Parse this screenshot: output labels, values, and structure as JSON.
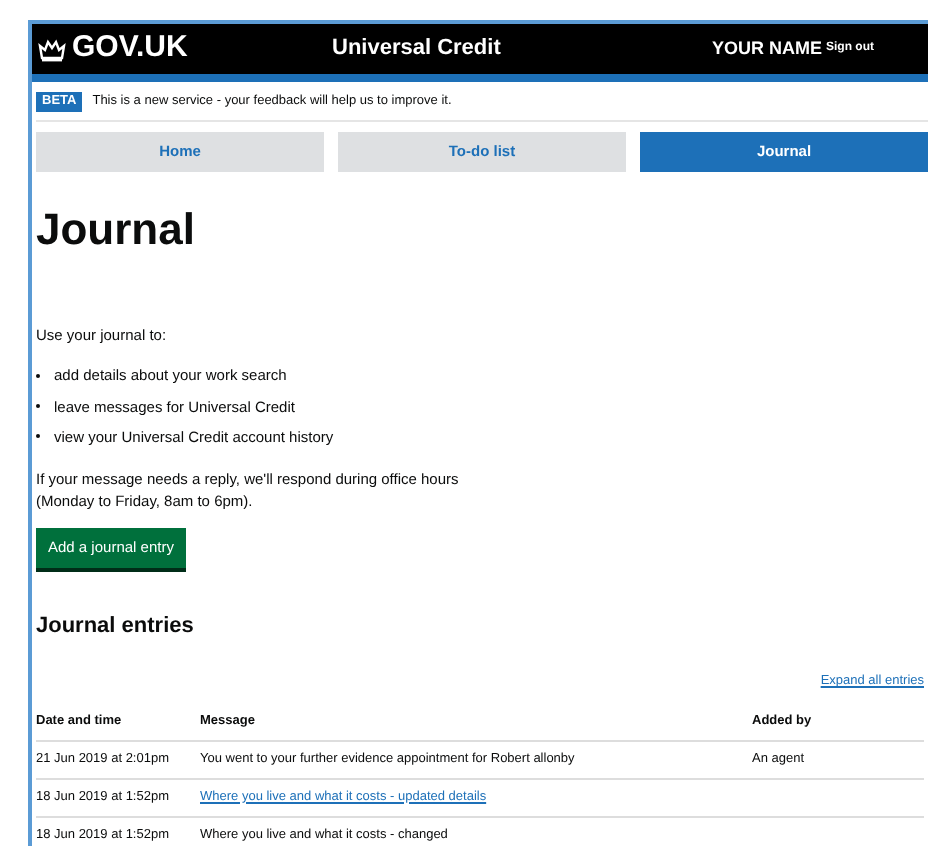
{
  "header": {
    "logo": "GOV.UK",
    "service": "Universal Credit",
    "user": "YOUR NAME",
    "sign_out": "Sign out"
  },
  "beta": {
    "tag": "BETA",
    "text": "This is a new service - your feedback will help us to improve it."
  },
  "tabs": [
    {
      "label": "Home",
      "selected": false
    },
    {
      "label": "To-do list",
      "selected": false
    },
    {
      "label": "Journal",
      "selected": true
    }
  ],
  "title": "Journal",
  "intro": "Use your journal to:",
  "bullets": [
    "add details about your work search",
    "leave messages for Universal Credit",
    "view your Universal Credit account history"
  ],
  "reply_note": "If your message needs a reply, we'll respond during office hours (Monday to Friday, 8am to 6pm).",
  "add_button": "Add a journal entry",
  "entries_title": "Journal entries",
  "expand_link": "Expand all entries",
  "table": {
    "columns": [
      "Date and time",
      "Message",
      "Added by"
    ],
    "rows": [
      {
        "date": "21 Jun 2019 at 2:01pm",
        "message": "You went to your further evidence appointment for Robert allonby",
        "kind": "text",
        "added_by": "An agent"
      },
      {
        "date": "18 Jun 2019 at 1:52pm",
        "message": "Where you live and what it costs - updated details",
        "kind": "link"
      },
      {
        "date": "18 Jun 2019 at 1:52pm",
        "message": "Where you live and what it costs - changed",
        "kind": "text"
      }
    ]
  }
}
